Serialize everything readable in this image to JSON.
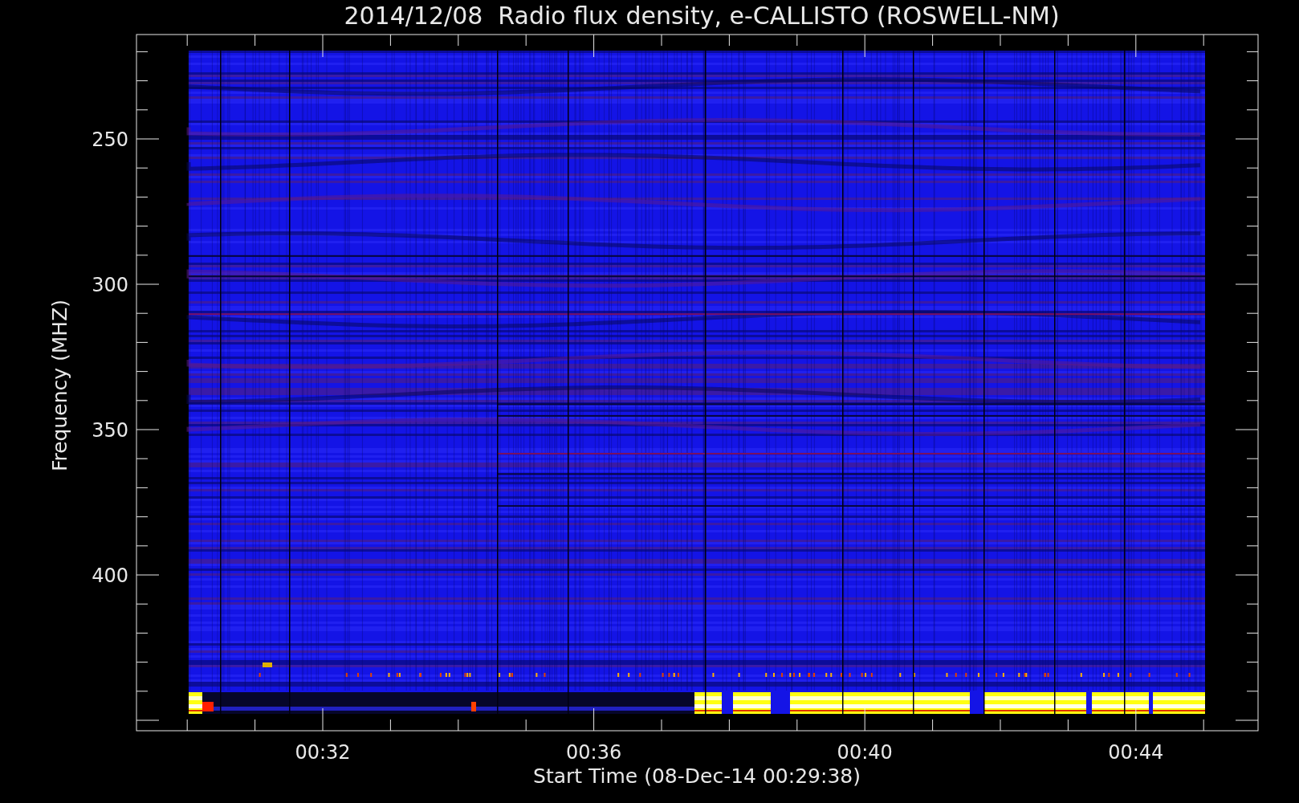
{
  "title": "2014/12/08  Radio flux density, e-CALLISTO (ROSWELL-NM)",
  "y_axis": {
    "label": "Frequency (MHZ)",
    "ticks": [
      "250",
      "300",
      "350",
      "400"
    ]
  },
  "x_axis": {
    "label": "Start Time (08-Dec-14 00:29:38)",
    "ticks": [
      "00:32",
      "00:36",
      "00:40",
      "00:44"
    ]
  }
}
